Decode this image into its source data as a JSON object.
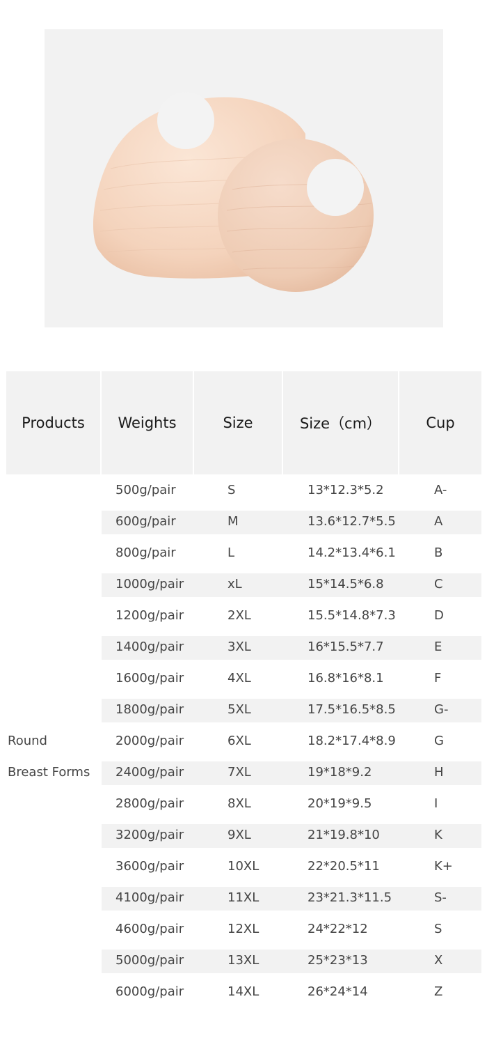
{
  "image": {
    "subject": "product-photo",
    "background": "#f2f2f2",
    "item_color": "#f3d3bd"
  },
  "table": {
    "headers": [
      "Products",
      "Weights",
      "Size",
      "Size（cm）",
      "Cup"
    ],
    "product_lines": [
      "Round",
      "Breast Forms"
    ],
    "rows": [
      {
        "weight": "500g/pair",
        "size": "S",
        "size_cm": "13*12.3*5.2",
        "cup": "A-"
      },
      {
        "weight": "600g/pair",
        "size": "M",
        "size_cm": "13.6*12.7*5.5",
        "cup": "A"
      },
      {
        "weight": "800g/pair",
        "size": "L",
        "size_cm": "14.2*13.4*6.1",
        "cup": "B"
      },
      {
        "weight": "1000g/pair",
        "size": "xL",
        "size_cm": "15*14.5*6.8",
        "cup": "C"
      },
      {
        "weight": "1200g/pair",
        "size": "2XL",
        "size_cm": "15.5*14.8*7.3",
        "cup": "D"
      },
      {
        "weight": "1400g/pair",
        "size": "3XL",
        "size_cm": "16*15.5*7.7",
        "cup": "E"
      },
      {
        "weight": "1600g/pair",
        "size": "4XL",
        "size_cm": "16.8*16*8.1",
        "cup": "F"
      },
      {
        "weight": "1800g/pair",
        "size": "5XL",
        "size_cm": "17.5*16.5*8.5",
        "cup": "G-"
      },
      {
        "weight": "2000g/pair",
        "size": "6XL",
        "size_cm": "18.2*17.4*8.9",
        "cup": "G"
      },
      {
        "weight": "2400g/pair",
        "size": "7XL",
        "size_cm": "19*18*9.2",
        "cup": "H"
      },
      {
        "weight": "2800g/pair",
        "size": "8XL",
        "size_cm": "20*19*9.5",
        "cup": "I"
      },
      {
        "weight": "3200g/pair",
        "size": "9XL",
        "size_cm": "21*19.8*10",
        "cup": "K"
      },
      {
        "weight": "3600g/pair",
        "size": "10XL",
        "size_cm": "22*20.5*11",
        "cup": "K+"
      },
      {
        "weight": "4100g/pair",
        "size": "11XL",
        "size_cm": "23*21.3*11.5",
        "cup": "S-"
      },
      {
        "weight": "4600g/pair",
        "size": "12XL",
        "size_cm": "24*22*12",
        "cup": "S"
      },
      {
        "weight": "5000g/pair",
        "size": "13XL",
        "size_cm": "25*23*13",
        "cup": "X"
      },
      {
        "weight": "6000g/pair",
        "size": "14XL",
        "size_cm": "26*24*14",
        "cup": "Z"
      }
    ]
  }
}
